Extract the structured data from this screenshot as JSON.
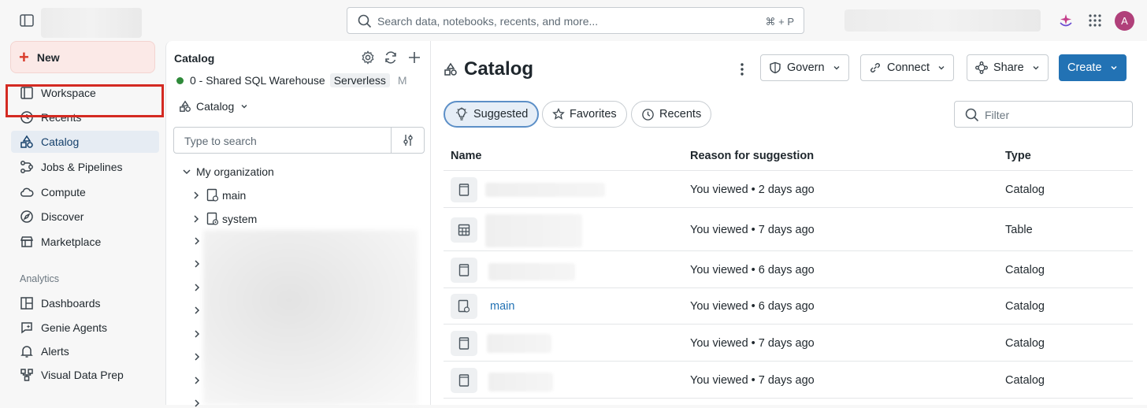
{
  "topbar": {
    "search_placeholder": "Search data, notebooks, recents, and more...",
    "search_shortcut": "⌘ + P",
    "avatar_initial": "A"
  },
  "sidebar": {
    "new_label": "New",
    "items": [
      {
        "label": "Workspace",
        "icon": "workspace-icon"
      },
      {
        "label": "Recents",
        "icon": "clock-icon"
      },
      {
        "label": "Catalog",
        "icon": "catalog-icon"
      },
      {
        "label": "Jobs & Pipelines",
        "icon": "workflow-icon"
      },
      {
        "label": "Compute",
        "icon": "cloud-icon"
      },
      {
        "label": "Discover",
        "icon": "compass-icon"
      },
      {
        "label": "Marketplace",
        "icon": "store-icon"
      }
    ],
    "analytics_label": "Analytics",
    "analytics_items": [
      {
        "label": "Dashboards",
        "icon": "dashboard-icon"
      },
      {
        "label": "Genie Agents",
        "icon": "genie-icon"
      },
      {
        "label": "Alerts",
        "icon": "bell-icon"
      },
      {
        "label": "Visual Data Prep",
        "icon": "data-prep-icon"
      }
    ]
  },
  "panel": {
    "title": "Catalog",
    "warehouse_name": "0 - Shared SQL Warehouse",
    "warehouse_badge": "Serverless",
    "warehouse_size": "M",
    "dropdown_label": "Catalog",
    "search_placeholder": "Type to search",
    "tree": {
      "org_label": "My organization",
      "items": [
        "main",
        "system"
      ]
    }
  },
  "main": {
    "title": "Catalog",
    "buttons": {
      "govern": "Govern",
      "connect": "Connect",
      "share": "Share",
      "create": "Create"
    },
    "tabs": [
      "Suggested",
      "Favorites",
      "Recents"
    ],
    "filter_placeholder": "Filter",
    "columns": [
      "Name",
      "Reason for suggestion",
      "Type"
    ],
    "rows": [
      {
        "name": "",
        "reason": "You viewed • 2 days ago",
        "type": "Catalog",
        "icon": "catalog-icon"
      },
      {
        "name": "",
        "reason": "You viewed • 7 days ago",
        "type": "Table",
        "icon": "table-icon"
      },
      {
        "name": "",
        "reason": "You viewed • 6 days ago",
        "type": "Catalog",
        "icon": "catalog-icon"
      },
      {
        "name": "main",
        "reason": "You viewed • 6 days ago",
        "type": "Catalog",
        "icon": "catalog-lock-icon"
      },
      {
        "name": "",
        "reason": "You viewed • 7 days ago",
        "type": "Catalog",
        "icon": "catalog-icon"
      },
      {
        "name": "",
        "reason": "You viewed • 7 days ago",
        "type": "Catalog",
        "icon": "catalog-icon"
      }
    ]
  },
  "colors": {
    "accent": "#2272b4",
    "highlight": "#d42a22",
    "new_plus": "#d93b2b"
  }
}
